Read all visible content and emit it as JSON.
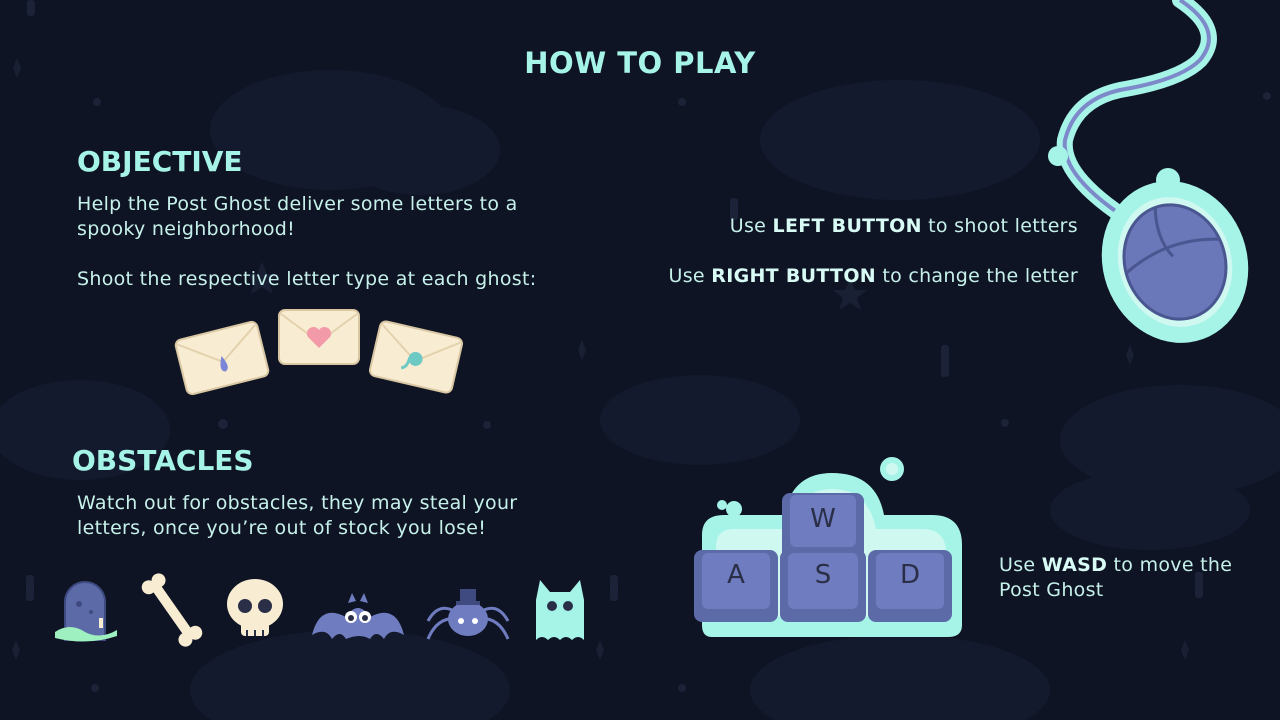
{
  "title": "HOW TO PLAY",
  "objective": {
    "heading": "OBJECTIVE",
    "line1": "Help the Post Ghost deliver some letters to a",
    "line2": "spooky neighborhood!",
    "line3": "Shoot the respective letter type at each ghost:",
    "letters": [
      "blue-drop",
      "pink-heart",
      "teal-comma"
    ]
  },
  "obstacles": {
    "heading": "OBSTACLES",
    "line1": "Watch out for obstacles, they may steal your",
    "line2": "letters, once you’re out of stock you lose!",
    "icons": [
      "tombstone-icon",
      "bone-icon",
      "skull-icon",
      "bat-icon",
      "spider-icon",
      "ghost-cat-icon"
    ]
  },
  "mouse": {
    "left": {
      "pre": "Use ",
      "key": "LEFT BUTTON",
      "post": " to shoot letters"
    },
    "right": {
      "pre": "Use ",
      "key": "RIGHT BUTTON",
      "post": " to change the letter"
    }
  },
  "keyboard": {
    "keys": [
      "W",
      "A",
      "S",
      "D"
    ],
    "pre": "Use ",
    "key": "WASD",
    "post": " to move the",
    "line2": "Post Ghost"
  },
  "colors": {
    "background": "#0f1424",
    "accent": "#a6f4e8",
    "text": "#c6f1ea",
    "key": "#6a77b8",
    "envelope": "#f8ecd2"
  }
}
